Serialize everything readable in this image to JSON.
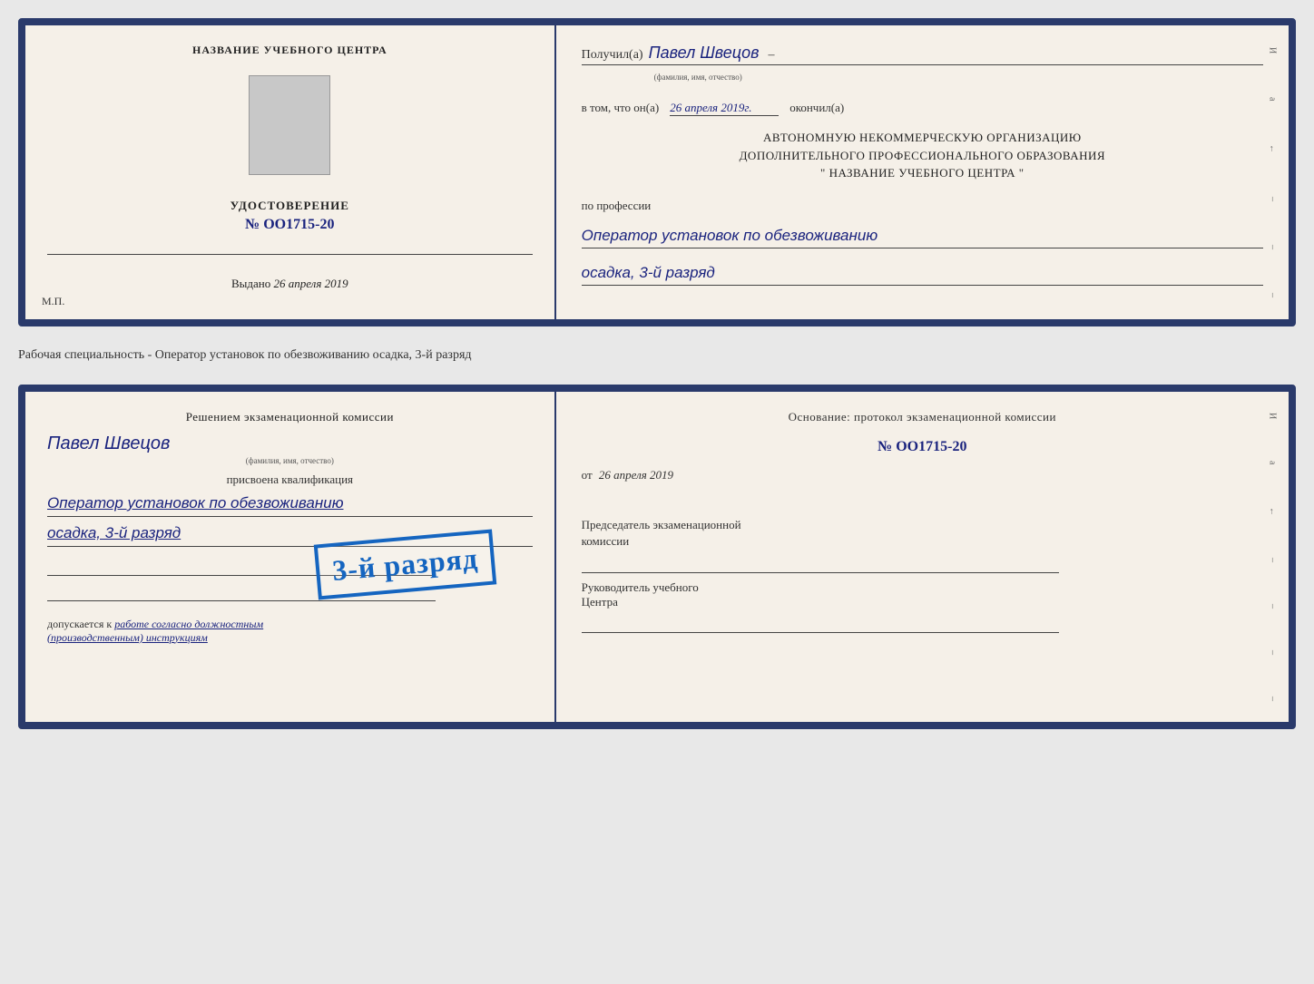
{
  "doc1": {
    "left": {
      "center_title": "НАЗВАНИЕ УЧЕБНОГО ЦЕНТРА",
      "cert_label": "УДОСТОВЕРЕНИЕ",
      "cert_number": "№ OO1715-20",
      "issued_prefix": "Выдано",
      "issued_date": "26 апреля 2019",
      "mp_label": "М.П."
    },
    "right": {
      "received_prefix": "Получил(а)",
      "received_name": "Павел Швецов",
      "name_subtext": "(фамилия, имя, отчество)",
      "dash": "–",
      "in_that_prefix": "в том, что он(а)",
      "in_that_date": "26 апреля 2019г.",
      "finished_label": "окончил(а)",
      "org_line1": "АВТОНОМНУЮ НЕКОММЕРЧЕСКУЮ ОРГАНИЗАЦИЮ",
      "org_line2": "ДОПОЛНИТЕЛЬНОГО ПРОФЕССИОНАЛЬНОГО ОБРАЗОВАНИЯ",
      "org_line3": "\"  НАЗВАНИЕ УЧЕБНОГО ЦЕНТРА  \"",
      "profession_prefix": "по профессии",
      "profession_value": "Оператор установок по обезвоживанию",
      "profession_value2": "осадка, 3-й разряд"
    }
  },
  "separator": {
    "text": "Рабочая специальность - Оператор установок по обезвоживанию осадка, 3-й разряд"
  },
  "doc2": {
    "left": {
      "decision_title": "Решением экзаменационной комиссии",
      "person_name": "Павел Швецов",
      "name_subtext": "(фамилия, имя, отчество)",
      "assigned_label": "присвоена квалификация",
      "qualification1": "Оператор установок по обезвоживанию",
      "qualification2": "осадка, 3-й разряд",
      "допускается_prefix": "допускается к",
      "допускается_val": "работе согласно должностным",
      "допускается_val2": "(производственным) инструкциям"
    },
    "stamp": {
      "text": "3-й разряд"
    },
    "right": {
      "basis_title": "Основание: протокол экзаменационной комиссии",
      "protocol_number": "№  OO1715-20",
      "from_prefix": "от",
      "from_date": "26 апреля 2019",
      "chairman_label": "Председатель экзаменационной",
      "chairman_label2": "комиссии",
      "head_label": "Руководитель учебного",
      "head_label2": "Центра"
    },
    "right_deco": [
      "И",
      "а",
      "←",
      "–",
      "–",
      "–",
      "–",
      "–"
    ]
  }
}
